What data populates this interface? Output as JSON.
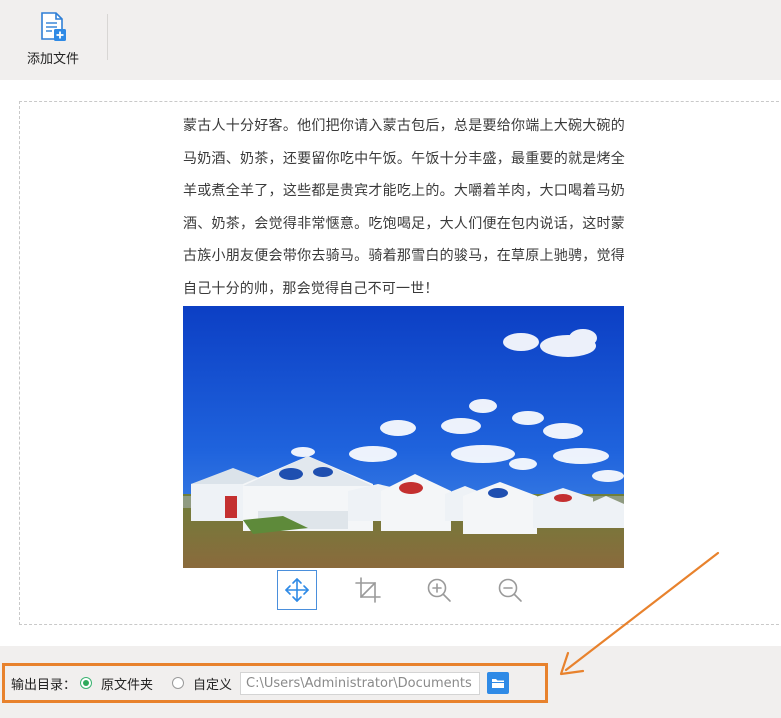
{
  "toolbar": {
    "add_file_label": "添加文件",
    "add_file_icon": "add-document-icon"
  },
  "article": {
    "text": "蒙古人十分好客。他们把你请入蒙古包后，总是要给你端上大碗大碗的马奶酒、奶茶，还要留你吃中午饭。午饭十分丰盛，最重要的就是烤全羊或煮全羊了，这些都是贵宾才能吃上的。大嚼着羊肉，大口喝着马奶酒、奶茶，会觉得非常惬意。吃饱喝足，大人们便在包内说话，这时蒙古族小朋友便会带你去骑马。骑着那雪白的骏马，在草原上驰骋，觉得自己十分的帅，那会觉得自己不可一世！"
  },
  "image_tools": [
    {
      "name": "move-icon",
      "active": true
    },
    {
      "name": "crop-icon",
      "active": false
    },
    {
      "name": "zoom-in-icon",
      "active": false
    },
    {
      "name": "zoom-out-icon",
      "active": false
    }
  ],
  "output": {
    "label": "输出目录：",
    "option_original": "原文件夹",
    "option_custom": "自定义",
    "selected": "原文件夹",
    "path": "C:\\Users\\Administrator\\Documents",
    "folder_icon": "folder-icon"
  },
  "colors": {
    "accent_blue": "#2f8ae6",
    "highlight_orange": "#e8822d",
    "radio_green": "#2eaa5b"
  }
}
